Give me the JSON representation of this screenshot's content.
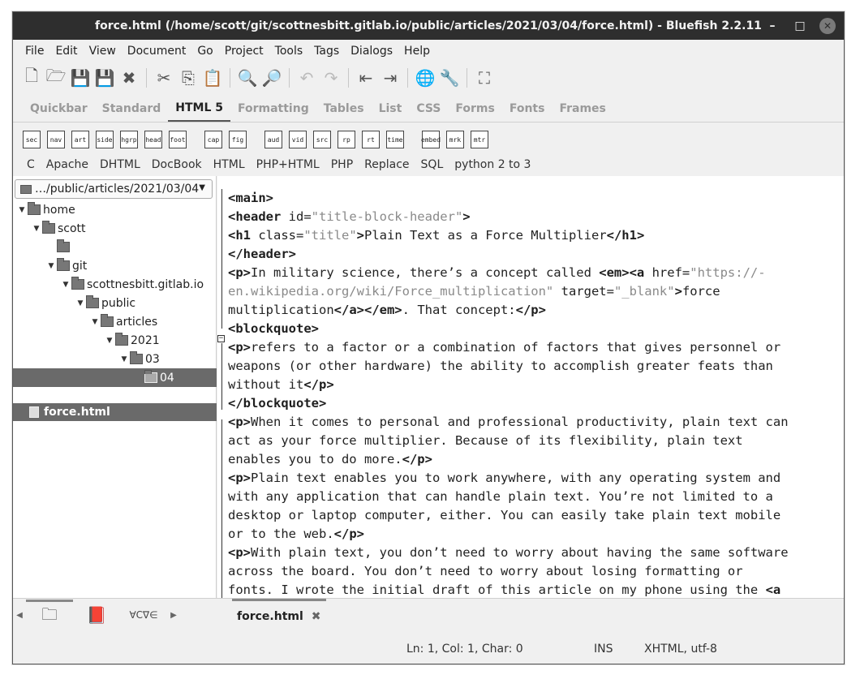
{
  "window": {
    "title": "force.html (/home/scott/git/scottnesbitt.gitlab.io/public/articles/2021/03/04/force.html) - Bluefish 2.2.11"
  },
  "window_controls": {
    "minimize": "–",
    "maximize": "□",
    "close": "✕"
  },
  "menubar": [
    "File",
    "Edit",
    "View",
    "Document",
    "Go",
    "Project",
    "Tools",
    "Tags",
    "Dialogs",
    "Help"
  ],
  "toolbar": {
    "icons": [
      "new-file-icon",
      "open-folder-icon",
      "save-icon",
      "save-as-icon",
      "close-icon",
      "cut-icon",
      "copy-icon",
      "paste-icon",
      "find-icon",
      "replace-icon",
      "undo-icon",
      "redo-icon",
      "unindent-icon",
      "indent-icon",
      "preview-icon",
      "preferences-icon",
      "fullscreen-icon"
    ],
    "glyphs": [
      "🗋",
      "🗁",
      "💾",
      "💾",
      "✖",
      "✂",
      "⎘",
      "📋",
      "🔍",
      "🔎",
      "↶",
      "↷",
      "⇤",
      "⇥",
      "🌐",
      "🔧",
      "⛶"
    ]
  },
  "tabs": [
    "Quickbar",
    "Standard",
    "HTML 5",
    "Formatting",
    "Tables",
    "List",
    "CSS",
    "Forms",
    "Fonts",
    "Frames"
  ],
  "active_tab": "HTML 5",
  "html5_icons": [
    "sec",
    "nav",
    "art",
    "side",
    "hgrp",
    "head",
    "foot",
    "cap",
    "fig",
    "aud",
    "vid",
    "src",
    "rp",
    "rt",
    "time",
    "embed",
    "mrk",
    "mtr"
  ],
  "snippets": [
    "C",
    "Apache",
    "DHTML",
    "DocBook",
    "HTML",
    "PHP+HTML",
    "PHP",
    "Replace",
    "SQL",
    "python 2 to 3"
  ],
  "filebrowser": {
    "path": "…/public/articles/2021/03/04",
    "tree": [
      {
        "label": "home",
        "depth": 0,
        "expanded": true
      },
      {
        "label": "scott",
        "depth": 1,
        "expanded": true
      },
      {
        "label": "",
        "depth": 2,
        "expanded": false
      },
      {
        "label": "git",
        "depth": 2,
        "expanded": true
      },
      {
        "label": "scottnesbitt.gitlab.io",
        "depth": 3,
        "expanded": true
      },
      {
        "label": "public",
        "depth": 4,
        "expanded": true
      },
      {
        "label": "articles",
        "depth": 5,
        "expanded": true
      },
      {
        "label": "2021",
        "depth": 6,
        "expanded": true
      },
      {
        "label": "03",
        "depth": 7,
        "expanded": true
      },
      {
        "label": "04",
        "depth": 8,
        "expanded": false,
        "selected": true
      }
    ],
    "files": [
      "force.html"
    ]
  },
  "editor": {
    "lines": [
      [
        [
          "t",
          "<main>"
        ]
      ],
      [
        [
          "t",
          "<header"
        ],
        [
          "a",
          " id="
        ],
        [
          "s",
          "\"title-block-header\""
        ],
        [
          "t",
          ">"
        ]
      ],
      [
        [
          "t",
          "<h1"
        ],
        [
          "a",
          " class="
        ],
        [
          "s",
          "\"title\""
        ],
        [
          "t",
          ">"
        ],
        [
          "a",
          "Plain Text as a Force Multiplier"
        ],
        [
          "t",
          "</h1>"
        ]
      ],
      [
        [
          "t",
          "</header>"
        ]
      ],
      [
        [
          "t",
          "<p>"
        ],
        [
          "a",
          "In military science, there’s a concept called "
        ],
        [
          "t",
          "<em><a"
        ],
        [
          "a",
          " href="
        ],
        [
          "s",
          "\"https://-"
        ]
      ],
      [
        [
          "s",
          "en.wikipedia.org/wiki/Force_multiplication\""
        ],
        [
          "a",
          " target="
        ],
        [
          "s",
          "\"_blank\""
        ],
        [
          "t",
          ">"
        ],
        [
          "a",
          "force"
        ]
      ],
      [
        [
          "a",
          "multiplication"
        ],
        [
          "t",
          "</a></em>"
        ],
        [
          "a",
          ". That concept:"
        ],
        [
          "t",
          "</p>"
        ]
      ],
      [
        [
          "t",
          "<blockquote>"
        ]
      ],
      [
        [
          "t",
          "<p>"
        ],
        [
          "a",
          "refers to a factor or a combination of factors that gives personnel or"
        ]
      ],
      [
        [
          "a",
          "weapons (or other hardware) the ability to accomplish greater feats than"
        ]
      ],
      [
        [
          "a",
          "without it"
        ],
        [
          "t",
          "</p>"
        ]
      ],
      [
        [
          "t",
          "</blockquote>"
        ]
      ],
      [
        [
          "t",
          "<p>"
        ],
        [
          "a",
          "When it comes to personal and professional productivity, plain text can"
        ]
      ],
      [
        [
          "a",
          "act as your force multiplier. Because of its flexibility, plain text"
        ]
      ],
      [
        [
          "a",
          "enables you to do more."
        ],
        [
          "t",
          "</p>"
        ]
      ],
      [
        [
          "t",
          "<p>"
        ],
        [
          "a",
          "Plain text enables you to work anywhere, with any operating system and"
        ]
      ],
      [
        [
          "a",
          "with any application that can handle plain text. You’re not limited to a"
        ]
      ],
      [
        [
          "a",
          "desktop or laptop computer, either. You can easily take plain text mobile"
        ]
      ],
      [
        [
          "a",
          "or to the web."
        ],
        [
          "t",
          "</p>"
        ]
      ],
      [
        [
          "t",
          "<p>"
        ],
        [
          "a",
          "With plain text, you don’t need to worry about having the same software"
        ]
      ],
      [
        [
          "a",
          "across the board. You don’t need to worry about losing formatting or"
        ]
      ],
      [
        [
          "a",
          "fonts. I wrote the initial draft of this article on my phone using the "
        ],
        [
          "t",
          "<a"
        ]
      ]
    ]
  },
  "bottom": {
    "side_icons": [
      "folder-icon",
      "bookmarks-icon",
      "charmap-icon"
    ],
    "side_glyphs": [
      "🗀",
      "📕",
      "∀C∇∈"
    ],
    "doc_tab": "force.html",
    "doc_tab_close": "✖"
  },
  "status": {
    "position": "Ln: 1, Col: 1, Char: 0",
    "mode": "INS",
    "encoding": "XHTML, utf-8"
  }
}
